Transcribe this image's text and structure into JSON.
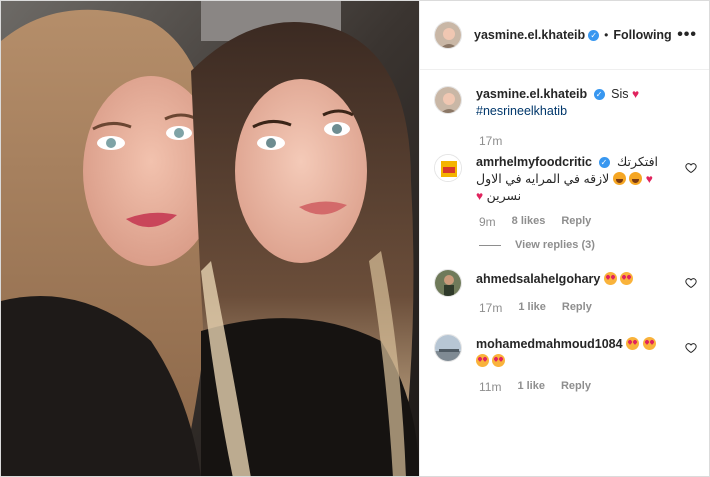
{
  "header": {
    "username": "yasmine.el.khateib",
    "follow_label": "Following",
    "bullet": "•",
    "more_label": "•••"
  },
  "caption": {
    "username": "yasmine.el.khateib",
    "text": "Sis",
    "hashtag": "#nesrineelkhatib",
    "time": "17m"
  },
  "comments": [
    {
      "username": "amrhelmyfoodcritic",
      "line1": "افتكرتك",
      "line2": "لازقه في المرايه في الاول",
      "line3": "نسرين",
      "time": "9m",
      "likes": "8 likes",
      "reply_label": "Reply",
      "view_replies": "View replies (3)"
    },
    {
      "username": "ahmedsalahelgohary",
      "time": "17m",
      "likes": "1 like",
      "reply_label": "Reply"
    },
    {
      "username": "mohamedmahmoud1084",
      "time": "11m",
      "likes": "1 like",
      "reply_label": "Reply"
    }
  ],
  "colors": {
    "verified": "#3897f0",
    "hashtag": "#00376b",
    "heart": "#e0245e",
    "meta": "#8e8e8e"
  }
}
